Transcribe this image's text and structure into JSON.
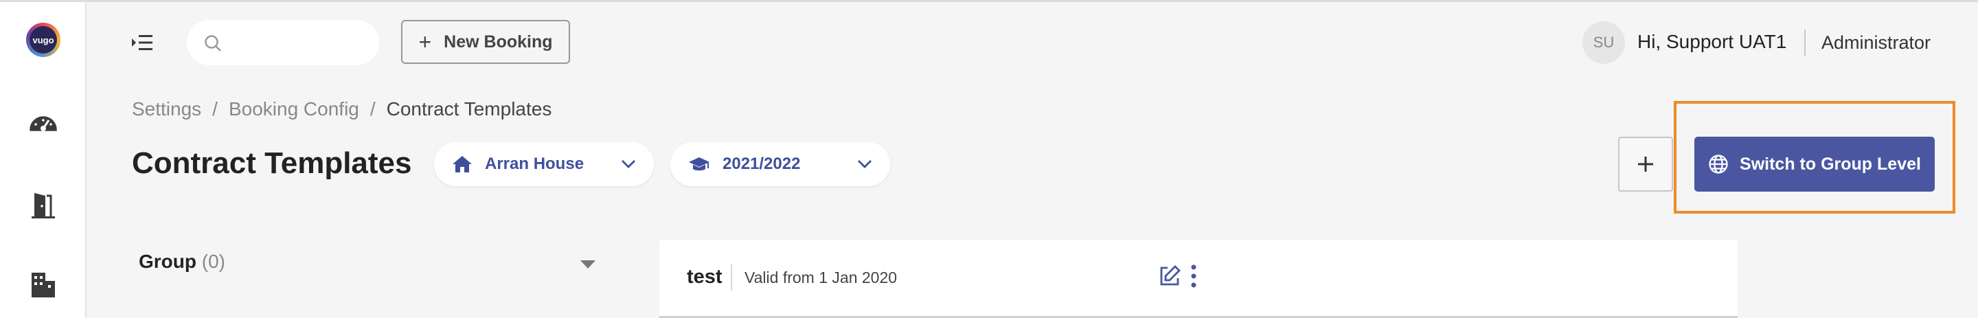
{
  "sidebar": {
    "logo_text": "vugo",
    "items": [
      {
        "icon": "dashboard-gauge-icon"
      },
      {
        "icon": "door-exit-icon"
      },
      {
        "icon": "buildings-icon"
      }
    ]
  },
  "header": {
    "search": {
      "placeholder": "",
      "value": ""
    },
    "new_booking_label": "New Booking",
    "user_initials": "SU",
    "greeting": "Hi, Support UAT1",
    "role": "Administrator"
  },
  "breadcrumb": {
    "items": [
      "Settings",
      "Booking Config",
      "Contract Templates"
    ],
    "separator": "/"
  },
  "page": {
    "title": "Contract Templates",
    "property_select": "Arran House",
    "year_select": "2021/2022",
    "switch_button_label": "Switch to Group Level"
  },
  "groups": {
    "label": "Group",
    "count": "(0)"
  },
  "templates": [
    {
      "name": "test",
      "valid": "Valid from 1 Jan 2020"
    }
  ],
  "colors": {
    "accent": "#4a56a0",
    "pill_text": "#3f4f9d",
    "highlight": "#ec8b2b",
    "background": "#f4f5f4"
  }
}
